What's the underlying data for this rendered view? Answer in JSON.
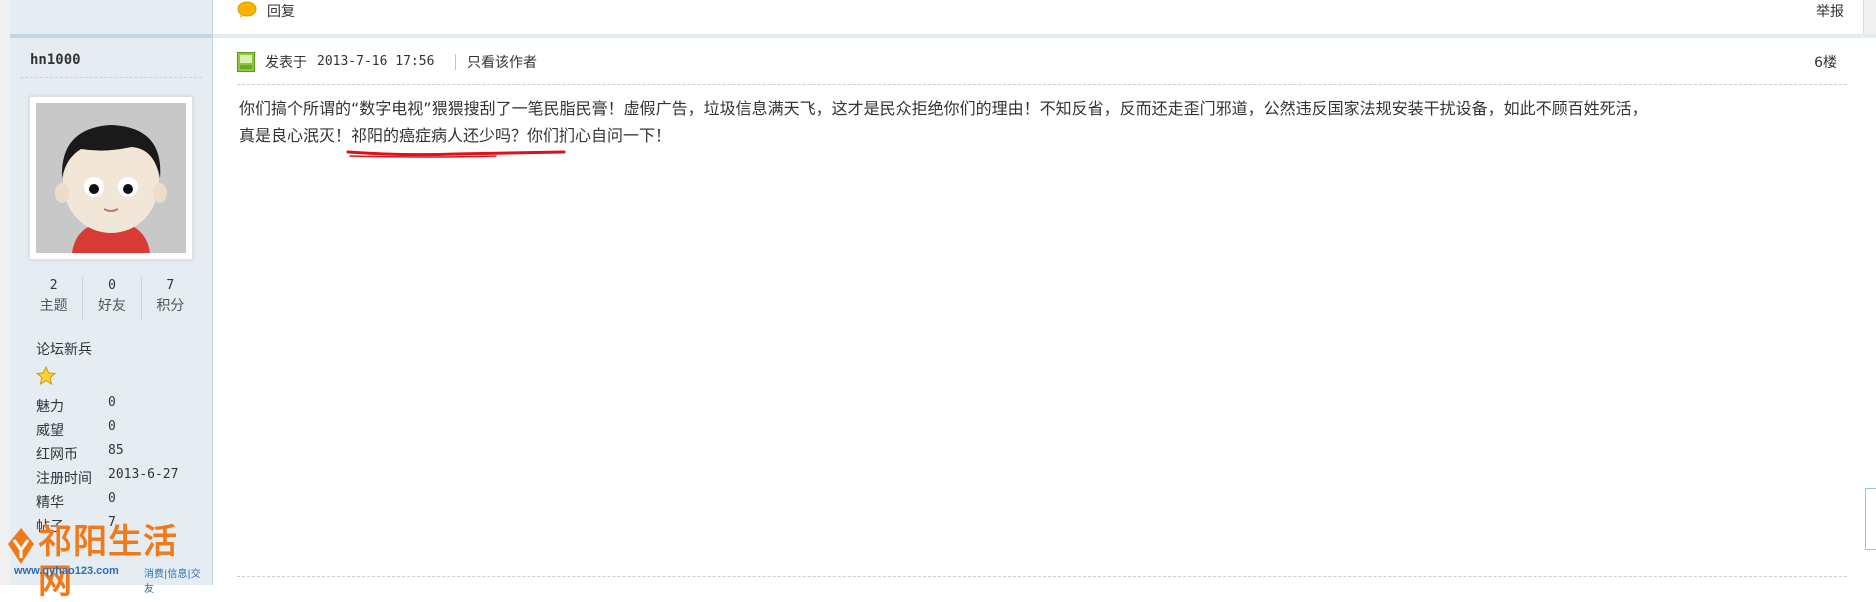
{
  "toolbar": {
    "reply_label": "回复",
    "report_label": "举报"
  },
  "user": {
    "name": "hn1000",
    "stats": [
      {
        "value": "2",
        "label": "主题"
      },
      {
        "value": "0",
        "label": "好友"
      },
      {
        "value": "7",
        "label": "积分"
      }
    ],
    "rank": "论坛新兵",
    "props": [
      {
        "label": "魅力",
        "value": "0"
      },
      {
        "label": "威望",
        "value": "0"
      },
      {
        "label": "红网币",
        "value": "85"
      },
      {
        "label": "注册时间",
        "value": "2013-6-27"
      },
      {
        "label": "精华",
        "value": "0"
      },
      {
        "label": "帖子",
        "value": "7"
      }
    ]
  },
  "post": {
    "posted_label": "发表于",
    "posted_time": "2013-7-16 17:56",
    "author_only": "只看该作者",
    "floor": "6楼",
    "body_line1": "你们搞个所谓的“数字电视”猥猥搜刮了一笔民脂民膏！虚假广告，垃圾信息满天飞，这才是民众拒绝你们的理由！不知反省，反而还走歪门邪道，公然违反国家法规安装干扰设备，如此不顾百姓死活，",
    "body_line2_a": "真是良心泯灭！",
    "body_line2_b": "祁阳的癌症病人还少吗？",
    "body_line2_c": "你们扪心自问一下！"
  },
  "watermark": {
    "title": "祁阳生活网",
    "url": "www.qyhao123.com",
    "tags": "消费|信息|交友"
  },
  "colors": {
    "sidebar_bg": "#e5edf2",
    "border": "#c2d5e3",
    "underline": "#e0101a",
    "watermark_orange": "#f07a1a",
    "watermark_blue": "#2a6eb8"
  },
  "icons": [
    "reply-bubble-icon",
    "online-status-icon",
    "rank-star-icon",
    "watermark-logo-icon"
  ]
}
